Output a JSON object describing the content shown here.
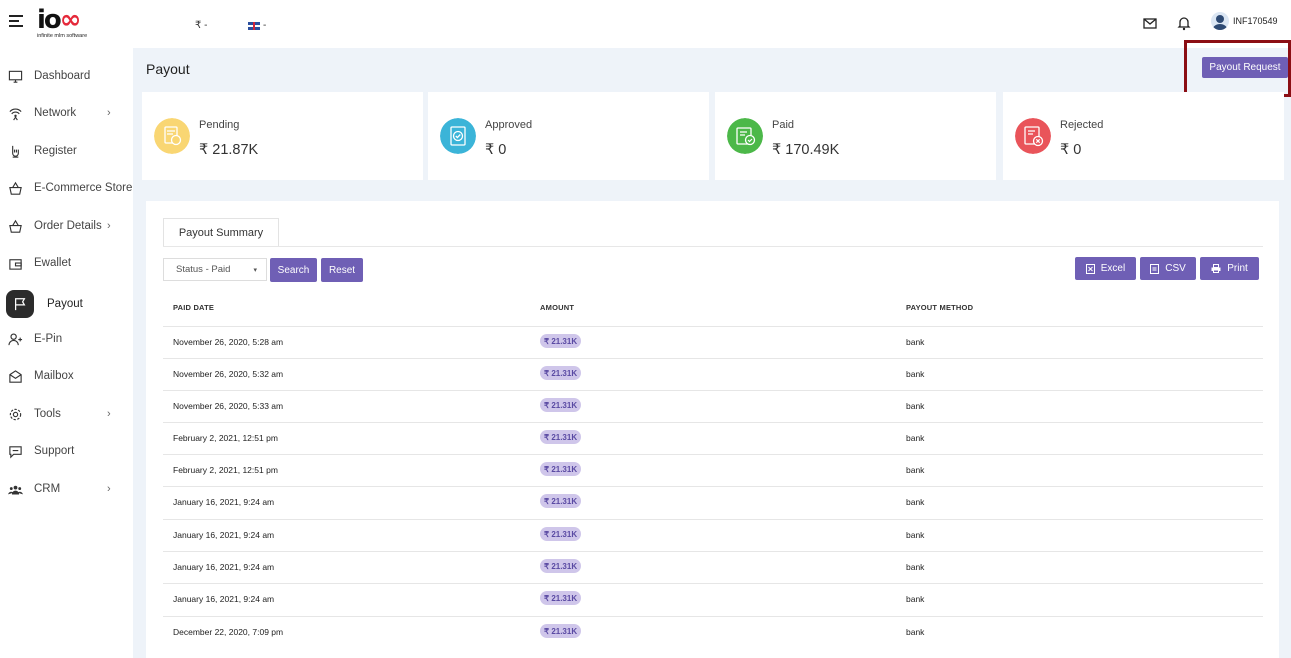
{
  "header": {
    "logo_text_a": "io",
    "logo_text_b": "∞",
    "logo_sub": "infinite mlm software",
    "currency": "₹ -",
    "language": "-",
    "username": "INF170549"
  },
  "sidebar": {
    "items": [
      {
        "label": "Dashboard",
        "icon": "monitor-icon",
        "chevron": ""
      },
      {
        "label": "Network",
        "icon": "network-icon",
        "chevron": "›"
      },
      {
        "label": "Register",
        "icon": "register-icon",
        "chevron": ""
      },
      {
        "label": "E-Commerce Store",
        "icon": "basket-icon",
        "chevron": ""
      },
      {
        "label": "Order Details",
        "icon": "basket-icon",
        "chevron": "›"
      },
      {
        "label": "Ewallet",
        "icon": "wallet-icon",
        "chevron": ""
      },
      {
        "label": "Payout",
        "icon": "flag-icon",
        "chevron": ""
      },
      {
        "label": "E-Pin",
        "icon": "user-plus-icon",
        "chevron": ""
      },
      {
        "label": "Mailbox",
        "icon": "mail-icon",
        "chevron": ""
      },
      {
        "label": "Tools",
        "icon": "gear-icon",
        "chevron": "›"
      },
      {
        "label": "Support",
        "icon": "chat-icon",
        "chevron": ""
      },
      {
        "label": "CRM",
        "icon": "users-icon",
        "chevron": "›"
      }
    ]
  },
  "page": {
    "title": "Payout",
    "payout_request": "Payout Request"
  },
  "cards": [
    {
      "label": "Pending",
      "value": "₹ 21.87K",
      "color": "#f9d673"
    },
    {
      "label": "Approved",
      "value": "₹ 0",
      "color": "#3bb4d8"
    },
    {
      "label": "Paid",
      "value": "₹ 170.49K",
      "color": "#4cb849"
    },
    {
      "label": "Rejected",
      "value": "₹ 0",
      "color": "#e9545a"
    }
  ],
  "panel": {
    "tab": "Payout Summary",
    "status_filter": "Status - Paid",
    "search": "Search",
    "reset": "Reset",
    "excel": "Excel",
    "csv": "CSV",
    "print": "Print",
    "columns": [
      "PAID DATE",
      "AMOUNT",
      "PAYOUT METHOD"
    ],
    "rows": [
      {
        "date": "November 26, 2020, 5:28 am",
        "amount": "₹ 21.31K",
        "method": "bank"
      },
      {
        "date": "November 26, 2020, 5:32 am",
        "amount": "₹ 21.31K",
        "method": "bank"
      },
      {
        "date": "November 26, 2020, 5:33 am",
        "amount": "₹ 21.31K",
        "method": "bank"
      },
      {
        "date": "February 2, 2021, 12:51 pm",
        "amount": "₹ 21.31K",
        "method": "bank"
      },
      {
        "date": "February 2, 2021, 12:51 pm",
        "amount": "₹ 21.31K",
        "method": "bank"
      },
      {
        "date": "January 16, 2021, 9:24 am",
        "amount": "₹ 21.31K",
        "method": "bank"
      },
      {
        "date": "January 16, 2021, 9:24 am",
        "amount": "₹ 21.31K",
        "method": "bank"
      },
      {
        "date": "January 16, 2021, 9:24 am",
        "amount": "₹ 21.31K",
        "method": "bank"
      },
      {
        "date": "January 16, 2021, 9:24 am",
        "amount": "₹ 21.31K",
        "method": "bank"
      },
      {
        "date": "December 22, 2020, 7:09 pm",
        "amount": "₹ 21.31K",
        "method": "bank"
      }
    ]
  },
  "colors": {
    "accent": "#6f5fb5",
    "highlight_border": "#8b0e14",
    "amount_badge_bg": "#cfc6ea"
  }
}
